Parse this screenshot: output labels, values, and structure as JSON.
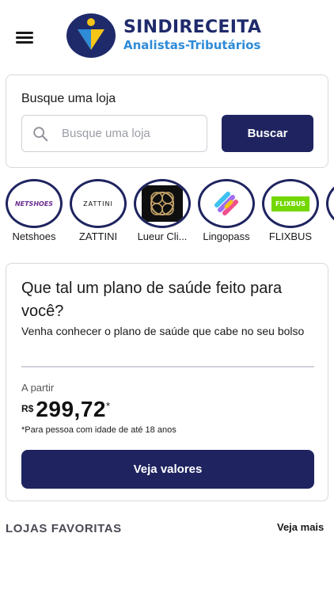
{
  "header": {
    "menu_icon": "hamburger-menu-icon",
    "logo_title": "SINDIRECEITA",
    "logo_subtitle": "Analistas-Tributários"
  },
  "search": {
    "label": "Busque uma loja",
    "placeholder": "Busque uma loja",
    "value": "",
    "icon": "search-icon",
    "button_label": "Buscar"
  },
  "stores": [
    {
      "name": "Netshoes",
      "logo_text": "NETSHOES"
    },
    {
      "name": "ZATTINI",
      "logo_text": "ZATTINI"
    },
    {
      "name": "Lueur Cli...",
      "logo_text": ""
    },
    {
      "name": "Lingopass",
      "logo_text": ""
    },
    {
      "name": "FLIXBUS",
      "logo_text": "FLIXBUS"
    }
  ],
  "plan": {
    "title": "Que tal um plano de saúde feito para você?",
    "description": "Venha conhecer o plano de saúde que cabe no seu bolso",
    "from_label": "A partir",
    "currency": "R$",
    "price": "299,72",
    "price_mark": "*",
    "note": "*Para pessoa com idade de até 18 anos",
    "button_label": "Veja valores"
  },
  "favorites": {
    "title": "LOJAS FAVORITAS",
    "see_more": "Veja mais"
  },
  "colors": {
    "primary": "#1f2460",
    "logo_blue": "#1f2a6b",
    "logo_light_blue": "#2e8bd8",
    "flixbus_green": "#73d700"
  }
}
